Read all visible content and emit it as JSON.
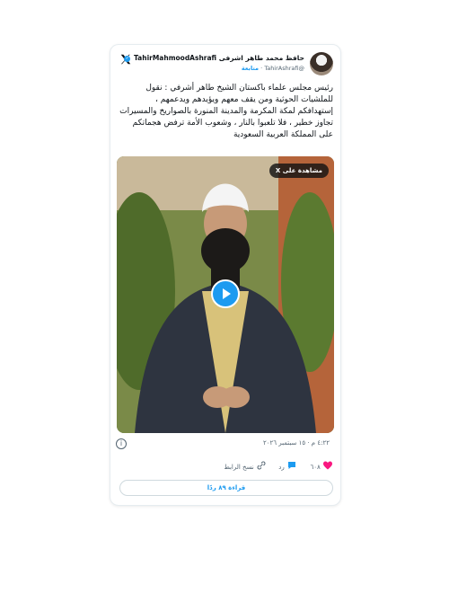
{
  "account": {
    "display_name": "حافظ محمد طاهر اشرفی TahirMahmoodAshrafi",
    "handle": "@TahirAshrafi",
    "follow_label": "متابعة",
    "separator": "·"
  },
  "tweet": {
    "lines": [
      "رئيس مجلس علماء باكستان الشيخ طاهر أشرفي : نقول",
      "للملشيات الحوثية ومن يقف معهم ويؤيدهم ويدعمهم ،",
      "إستهدافكم لمكة المكرمة والمدينة المنورة بالصواريخ والمسيرات",
      "تجاوز خطير ، فلا تلعبوا بالنار ، وشعوب الأمة ترفض هجماتكم",
      "على المملكة العربية السعودية"
    ]
  },
  "media": {
    "watch_label": "مشاهدة على X"
  },
  "meta": {
    "timestamp": "٤:٢٢ م · ١٥ سبتمبر ٢٠٢٦"
  },
  "actions": {
    "likes": "٦٠٨",
    "reply_label": "رد",
    "copy_link_label": "نسخ الرابط"
  },
  "read_replies_label": "قراءة ٨٩ ردًا",
  "colors": {
    "accent": "#1d9bf0",
    "like": "#f91880",
    "muted": "#536471"
  },
  "icons": [
    "x-logo-icon",
    "verified-badge-icon",
    "play-icon",
    "info-icon",
    "heart-icon",
    "reply-bubble-icon",
    "link-icon"
  ]
}
